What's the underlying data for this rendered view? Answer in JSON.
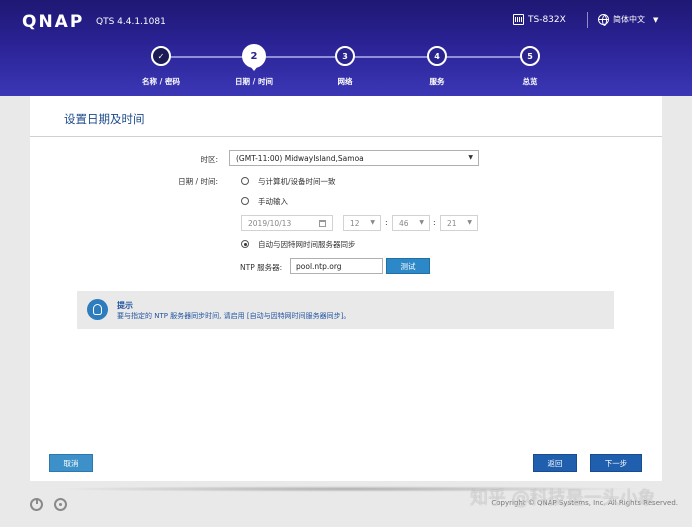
{
  "header": {
    "logo": "QNAP",
    "version": "QTS 4.4.1.1081",
    "model": "TS-832X",
    "language": "简体中文"
  },
  "steps": [
    {
      "number": "✓",
      "label": "名称 / 密码",
      "state": "done"
    },
    {
      "number": "2",
      "label": "日期 / 时间",
      "state": "active"
    },
    {
      "number": "3",
      "label": "网络",
      "state": "pending"
    },
    {
      "number": "4",
      "label": "服务",
      "state": "pending"
    },
    {
      "number": "5",
      "label": "总览",
      "state": "pending"
    }
  ],
  "panel": {
    "title": "设置日期及时间",
    "timezone_label": "时区:",
    "timezone_value": "(GMT-11:00) MidwayIsland,Samoa",
    "datetime_label": "日期 / 时间:",
    "option_sync_computer": "与计算机/设备时间一致",
    "option_manual": "手动输入",
    "manual_date": "2019/10/13",
    "manual_hour": "12",
    "manual_minute": "46",
    "manual_second": "21",
    "option_ntp": "自动与因特网时间服务器同步",
    "selected_option": "ntp",
    "ntp_label": "NTP 服务器:",
    "ntp_value": "pool.ntp.org",
    "test_button": "测试"
  },
  "tip": {
    "title": "提示",
    "text": "要与指定的 NTP 服务器同步时间, 请启用 [自动与因特网时间服务器同步]。"
  },
  "buttons": {
    "cancel": "取消",
    "back": "返回",
    "next": "下一步"
  },
  "footer": {
    "copyright": "Copyright © QNAP Systems, Inc. All Rights Reserved.",
    "watermark": "知乎 @科技是一头小象"
  },
  "colors": {
    "header_top": "#1f1873",
    "header_bottom": "#3b37b5",
    "title_blue": "#1d4b8b",
    "button_primary": "#1f5fae",
    "button_test": "#2d88c7"
  }
}
